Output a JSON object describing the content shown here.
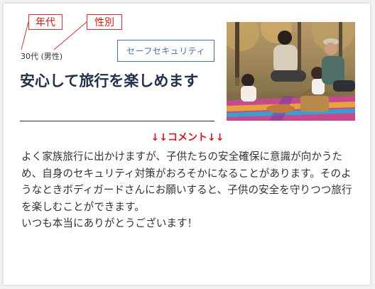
{
  "callouts": {
    "age": "年代",
    "gender": "性別"
  },
  "profile": {
    "age_gender": "30代 (男性)"
  },
  "tag": {
    "label": "セーフセキュリティ"
  },
  "title": "安心して旅行を楽しめます",
  "comment": {
    "heading": "↓↓コメント↓↓",
    "body": "よく家族旅行に出かけますが、子供たちの安全確保に意識が向かうため、自身のセキュリティ対策がおろそかになることがあります。そのようなときボディガードさんにお願いすると、子供の安全を守りつつ旅行を楽しむことができます。\nいつも本当にありがとうございます！"
  },
  "colors": {
    "accent_red": "#d11a1a",
    "navy": "#23304a",
    "tag_blue": "#4a6fa5"
  },
  "photo": {
    "icon": "family-picnic-photo"
  }
}
